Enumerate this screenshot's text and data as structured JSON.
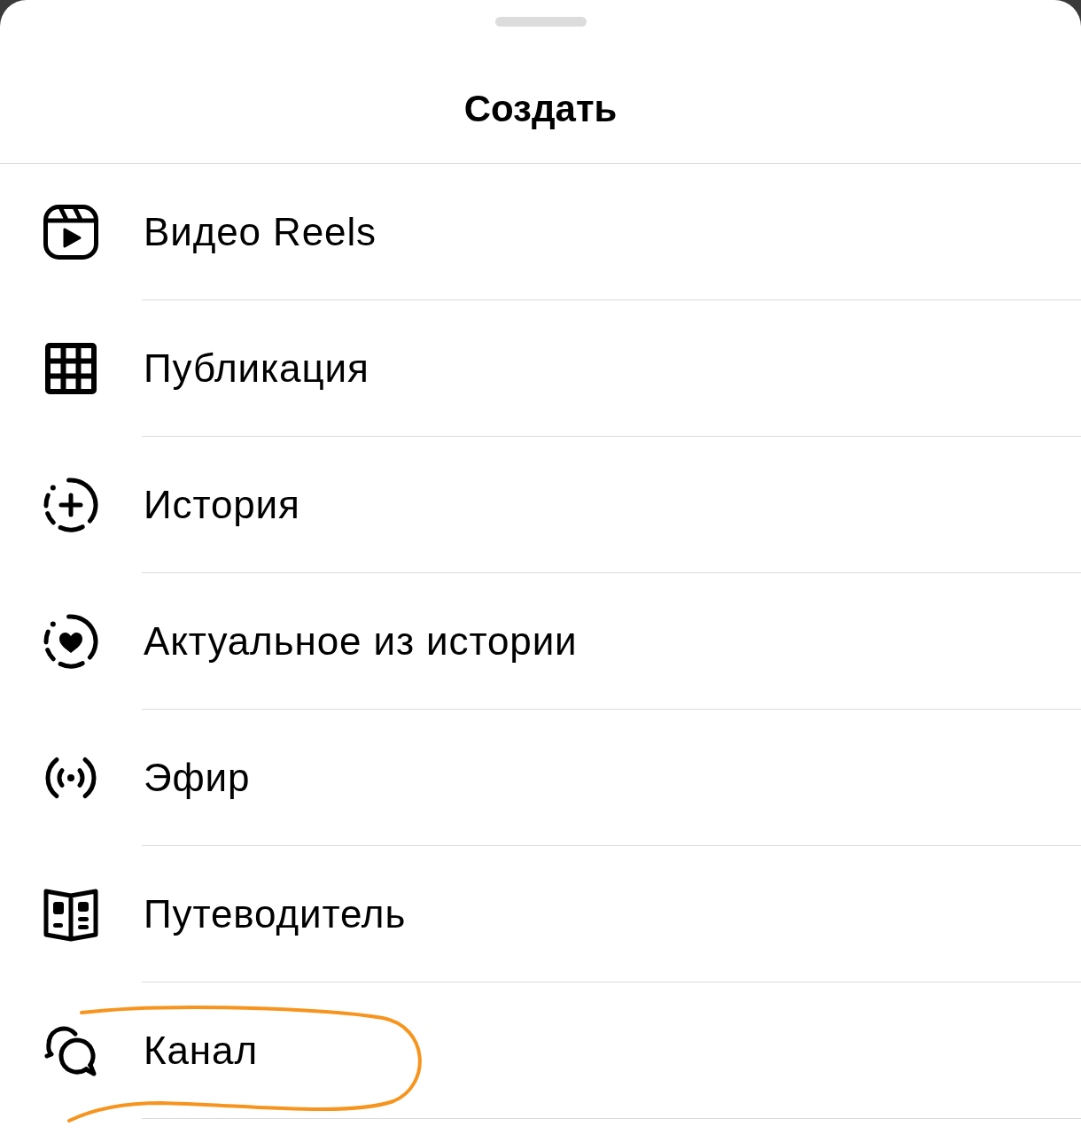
{
  "sheet": {
    "title": "Создать"
  },
  "items": [
    {
      "label": "Видео Reels",
      "highlighted": false
    },
    {
      "label": "Публикация",
      "highlighted": false
    },
    {
      "label": "История",
      "highlighted": false
    },
    {
      "label": "Актуальное из истории",
      "highlighted": false
    },
    {
      "label": "Эфир",
      "highlighted": false
    },
    {
      "label": "Путеводитель",
      "highlighted": false
    },
    {
      "label": "Канал",
      "highlighted": true
    }
  ]
}
